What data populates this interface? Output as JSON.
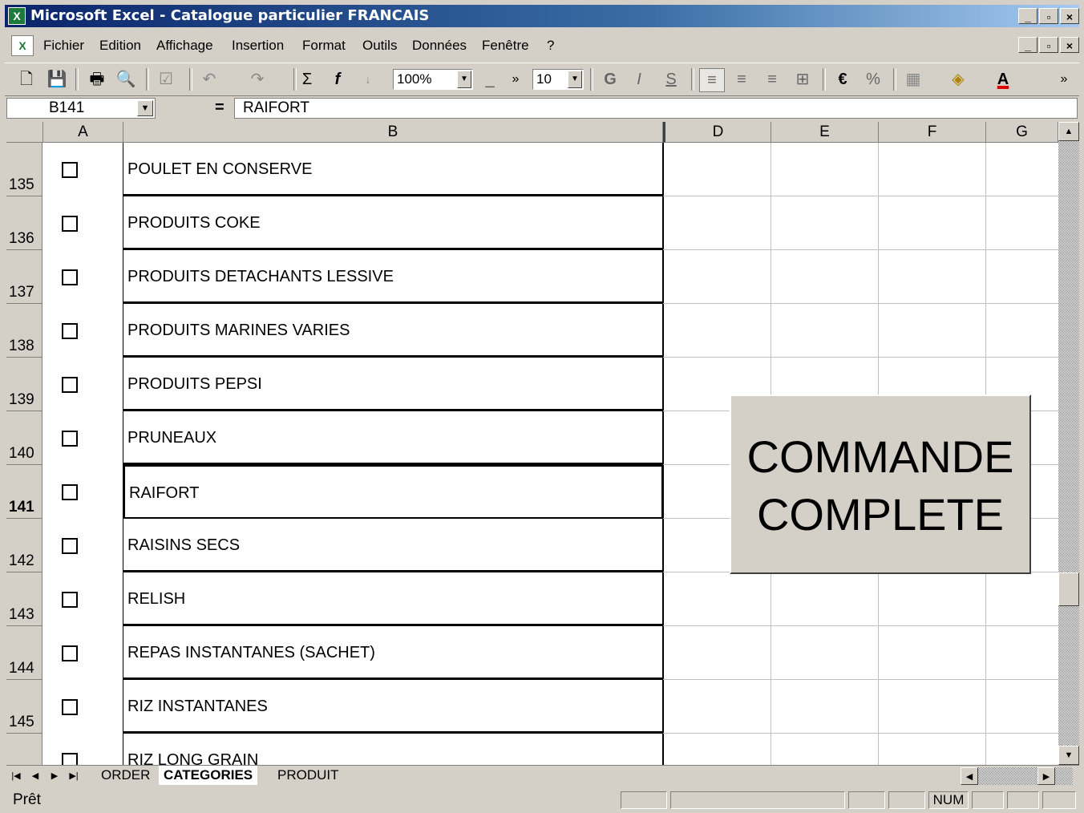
{
  "window": {
    "title": "Microsoft Excel - Catalogue particulier FRANCAIS",
    "controls": [
      "_",
      "□",
      "×"
    ]
  },
  "menu": {
    "items": [
      "Fichier",
      "Edition",
      "Affichage",
      "Insertion",
      "Format",
      "Outils",
      "Données",
      "Fenêtre",
      "?"
    ]
  },
  "toolbar": {
    "zoom": "100%",
    "font_size": "10"
  },
  "formula_bar": {
    "name_box": "B141",
    "equals": "=",
    "value": "RAIFORT"
  },
  "columns": [
    "A",
    "B",
    "D",
    "E",
    "F",
    "G"
  ],
  "rows": [
    {
      "number": "135",
      "item": "POULET EN CONSERVE"
    },
    {
      "number": "136",
      "item": "PRODUITS COKE"
    },
    {
      "number": "137",
      "item": "PRODUITS DETACHANTS LESSIVE"
    },
    {
      "number": "138",
      "item": "PRODUITS MARINES VARIES"
    },
    {
      "number": "139",
      "item": "PRODUITS PEPSI"
    },
    {
      "number": "140",
      "item": "PRUNEAUX"
    },
    {
      "number": "141",
      "item": "RAIFORT"
    },
    {
      "number": "142",
      "item": "RAISINS SECS"
    },
    {
      "number": "143",
      "item": "RELISH"
    },
    {
      "number": "144",
      "item": "REPAS INSTANTANES (SACHET)"
    },
    {
      "number": "145",
      "item": "RIZ INSTANTANES"
    },
    {
      "number": "",
      "item": "RIZ LONG GRAIN"
    }
  ],
  "active_row": "141",
  "order_button": {
    "line1": "COMMANDE",
    "line2": "COMPLETE"
  },
  "sheet_tabs": [
    "ORDER",
    "CATEGORIES",
    "PRODUIT"
  ],
  "active_sheet": "CATEGORIES",
  "status": {
    "text": "Prêt",
    "num": "NUM"
  }
}
